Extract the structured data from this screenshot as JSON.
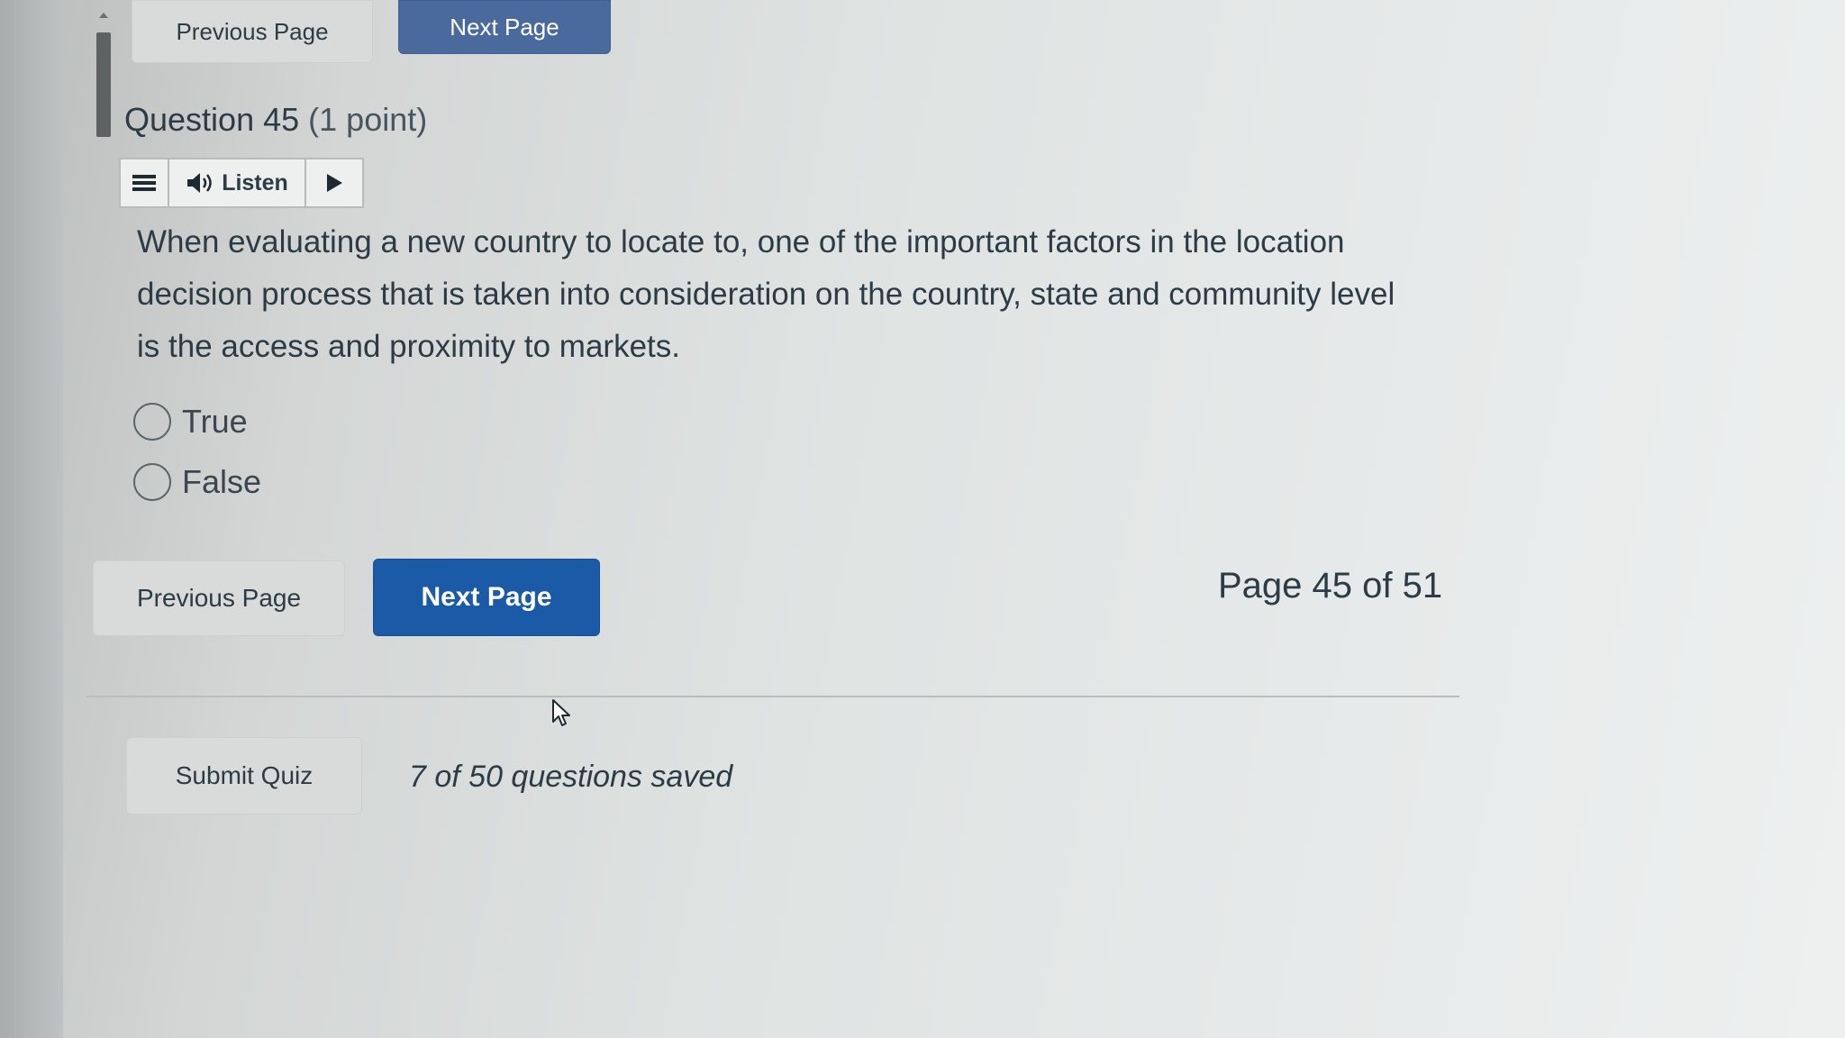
{
  "nav_top": {
    "previous_label": "Previous Page",
    "next_label": "Next Page"
  },
  "question": {
    "title": "Question 45",
    "points": "(1 point)",
    "text": "When evaluating a new country to locate to, one of the important factors in the location decision process that is taken into consideration on the country, state and community level is the access and proximity to markets.",
    "options": [
      {
        "label": "True",
        "selected": false
      },
      {
        "label": "False",
        "selected": false
      }
    ]
  },
  "listen_toolbar": {
    "menu_icon": "hamburger-menu-icon",
    "speaker_icon": "speaker-icon",
    "listen_label": "Listen",
    "play_icon": "play-icon"
  },
  "nav_bottom": {
    "previous_label": "Previous Page",
    "next_label": "Next Page",
    "page_indicator": "Page 45 of 51"
  },
  "footer": {
    "submit_label": "Submit Quiz",
    "saved_status": "7 of 50 questions saved"
  },
  "colors": {
    "primary": "#1b5aa6",
    "text": "#2d3b45",
    "secondary_button": "#d8dbda"
  }
}
